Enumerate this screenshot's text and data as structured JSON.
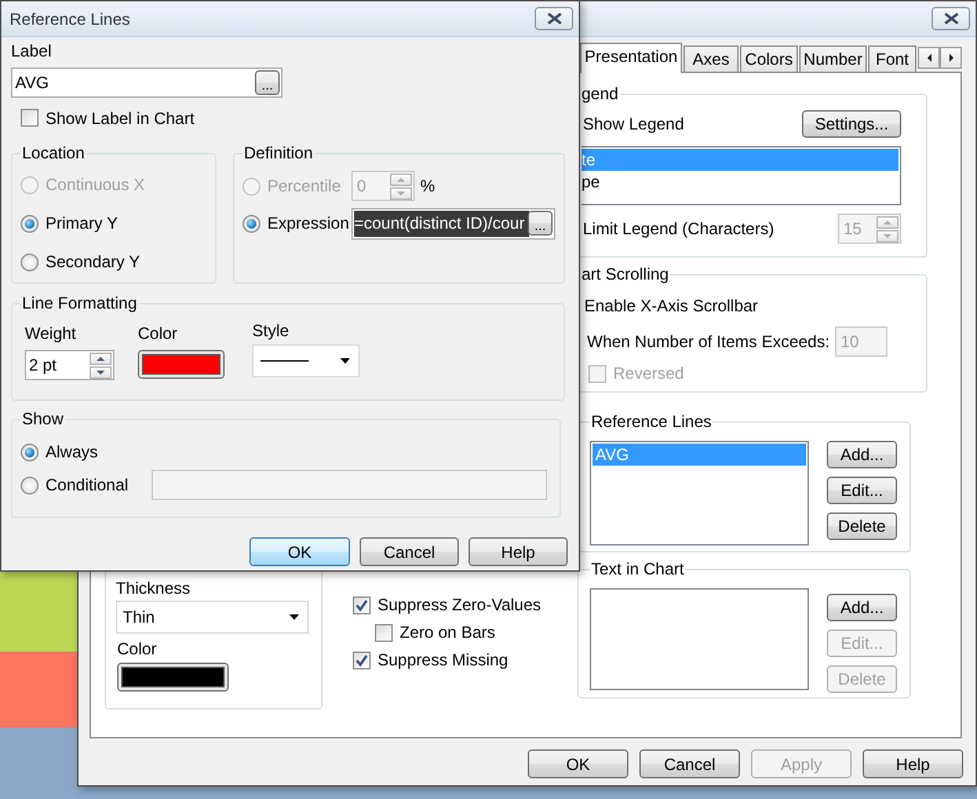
{
  "reference_lines_dialog": {
    "title": "Reference Lines",
    "label": {
      "caption": "Label",
      "value": "AVG",
      "browse_button": "..."
    },
    "show_label_in_chart": {
      "label": "Show Label in Chart",
      "checked": false
    },
    "location": {
      "title": "Location",
      "options": [
        {
          "label": "Continuous X",
          "selected": false,
          "disabled": true
        },
        {
          "label": "Primary Y",
          "selected": true,
          "disabled": false
        },
        {
          "label": "Secondary Y",
          "selected": false,
          "disabled": false
        }
      ]
    },
    "definition": {
      "title": "Definition",
      "options": [
        {
          "kind": "percentile",
          "label": "Percentile",
          "selected": false,
          "disabled": true,
          "value": "0",
          "unit": "%"
        },
        {
          "kind": "expression",
          "label": "Expression",
          "selected": true,
          "disabled": false,
          "value": "=count(distinct ID)/cour",
          "highlighted": true,
          "browse_button": "..."
        }
      ]
    },
    "line_formatting": {
      "title": "Line Formatting",
      "weight": {
        "label": "Weight",
        "value": "2 pt"
      },
      "color": {
        "label": "Color",
        "color": "#ff0000"
      },
      "style": {
        "label": "Style"
      }
    },
    "show": {
      "title": "Show",
      "options": [
        {
          "kind": "always",
          "label": "Always",
          "selected": true
        },
        {
          "kind": "conditional",
          "label": "Conditional",
          "selected": false
        }
      ]
    },
    "buttons": [
      {
        "label": "OK",
        "default": true
      },
      {
        "label": "Cancel",
        "default": false
      },
      {
        "label": "Help",
        "default": false
      }
    ]
  },
  "chart_properties_dialog": {
    "tabs": [
      {
        "label": "Presentation",
        "selected": true
      },
      {
        "label": "Axes",
        "selected": false
      },
      {
        "label": "Colors",
        "selected": false
      },
      {
        "label": "Number",
        "selected": false
      },
      {
        "label": "Font",
        "selected": false
      }
    ],
    "legend": {
      "title": "gend",
      "show_legend": "Show Legend",
      "settings_button": "Settings...",
      "items": [
        {
          "label": "te",
          "selected": true
        },
        {
          "label": "pe",
          "selected": false
        }
      ],
      "limit_legend": {
        "label": "Limit Legend (Characters)",
        "value": "15",
        "disabled": true
      }
    },
    "chart_scrolling": {
      "title": "art Scrolling",
      "enable_scrollbar": "Enable X-Axis Scrollbar",
      "items_exceed": {
        "label": "When Number of Items Exceeds:",
        "value": "10",
        "disabled": true
      },
      "reversed": {
        "label": "Reversed",
        "checked": false,
        "disabled": true
      }
    },
    "reference_lines": {
      "title": "Reference Lines",
      "items": [
        {
          "label": "AVG",
          "selected": true
        }
      ],
      "buttons": [
        {
          "label": "Add...",
          "disabled": false
        },
        {
          "label": "Edit...",
          "disabled": false
        },
        {
          "label": "Delete",
          "disabled": false
        }
      ]
    },
    "line": {
      "thickness_label": "Thickness",
      "thickness": "Thin",
      "color_label": "Color",
      "color": "#000000"
    },
    "options": [
      {
        "label": "Suppress Zero-Values",
        "checked": true,
        "children": [
          {
            "label": "Zero on Bars",
            "checked": false
          }
        ]
      },
      {
        "label": "Suppress Missing",
        "checked": true
      }
    ],
    "text_in_chart": {
      "title": "Text in Chart",
      "buttons": [
        {
          "label": "Add...",
          "disabled": false
        },
        {
          "label": "Edit...",
          "disabled": true
        },
        {
          "label": "Delete",
          "disabled": true
        }
      ]
    },
    "buttons": [
      {
        "label": "OK",
        "disabled": false
      },
      {
        "label": "Cancel",
        "disabled": false
      },
      {
        "label": "Apply",
        "disabled": true
      },
      {
        "label": "Help",
        "disabled": false
      }
    ]
  }
}
